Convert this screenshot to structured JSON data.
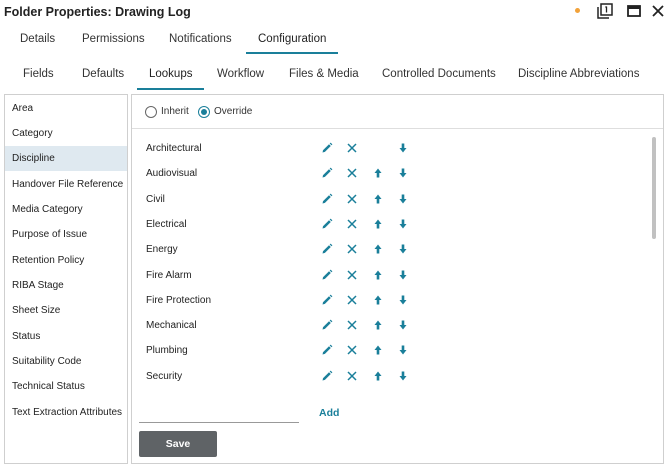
{
  "window": {
    "title": "Folder Properties: Drawing Log"
  },
  "top_tabs": [
    "Details",
    "Permissions",
    "Notifications",
    "Configuration"
  ],
  "sub_tabs": [
    "Fields",
    "Defaults",
    "Lookups",
    "Workflow",
    "Files & Media",
    "Controlled Documents",
    "Discipline Abbreviations"
  ],
  "sidebar": {
    "items": [
      "Area",
      "Category",
      "Discipline",
      "Handover File Reference",
      "Media Category",
      "Purpose of Issue",
      "Retention Policy",
      "RIBA Stage",
      "Sheet Size",
      "Status",
      "Suitability Code",
      "Technical Status",
      "Text Extraction Attributes"
    ],
    "selected": "Discipline"
  },
  "mode": {
    "inherit_label": "Inherit",
    "override_label": "Override",
    "selected": "Override"
  },
  "lookup_values": [
    "Architectural",
    "Audiovisual",
    "Civil",
    "Electrical",
    "Energy",
    "Fire Alarm",
    "Fire Protection",
    "Mechanical",
    "Plumbing",
    "Security"
  ],
  "actions": {
    "add_label": "Add",
    "add_placeholder": "",
    "save_label": "Save"
  },
  "colors": {
    "accent": "#1a7f9a",
    "save_button": "#5f6366",
    "selected_item": "#dfe9f0",
    "unsaved_dot": "#f2a23a"
  }
}
